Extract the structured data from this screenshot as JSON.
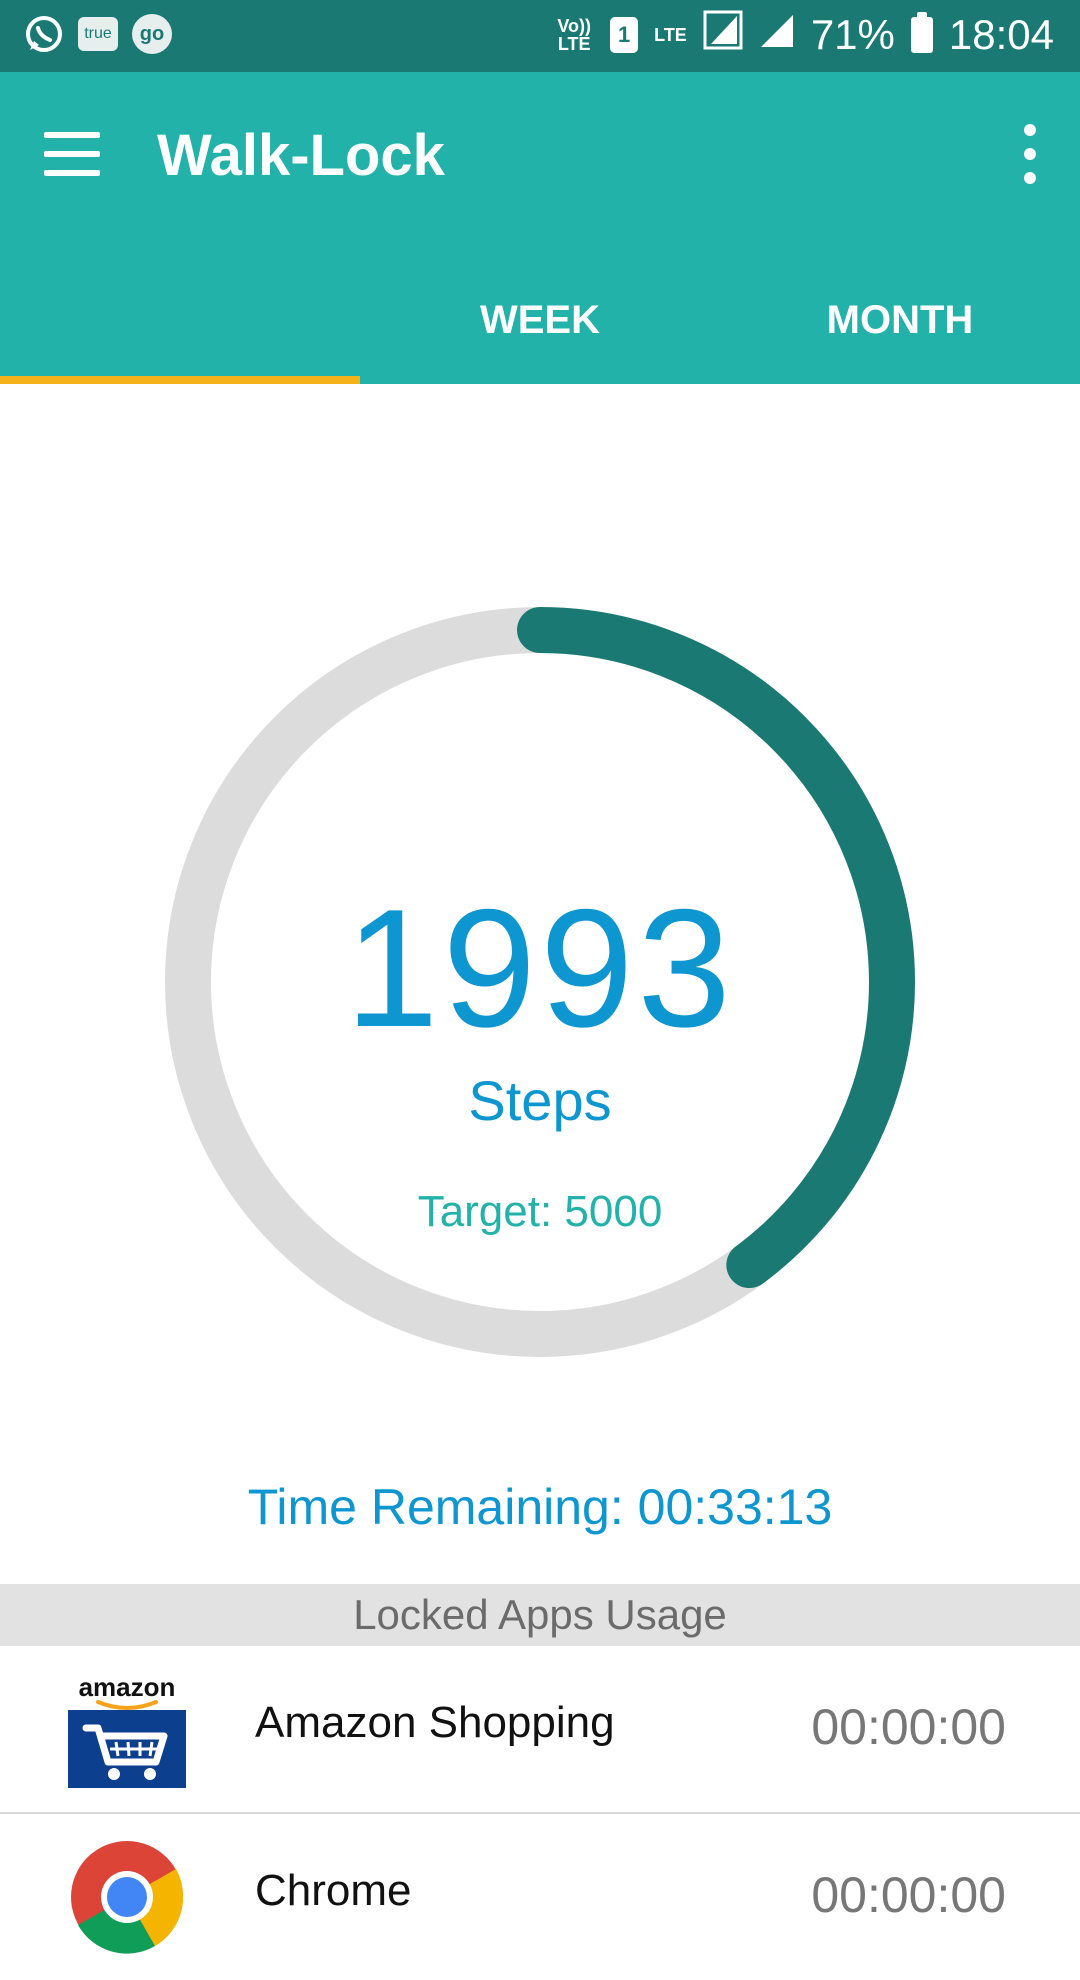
{
  "status_bar": {
    "left_icons": [
      "whatsapp-icon",
      "true-app-icon",
      "go-app-icon"
    ],
    "volte": "Vo)) LTE",
    "sim": "1",
    "lte": "LTE",
    "battery_percent": "71%",
    "time": "18:04"
  },
  "app_bar": {
    "title": "Walk-Lock",
    "tabs": [
      {
        "label": ""
      },
      {
        "label": "WEEK"
      },
      {
        "label": "MONTH"
      }
    ],
    "selected_tab": 0
  },
  "progress": {
    "steps": "1993",
    "steps_label": "Steps",
    "target_label": "Target: 5000",
    "fraction": 0.3986,
    "track_color": "#dcdcdc",
    "progress_color": "#1a7a73"
  },
  "time_remaining": "Time Remaining: 00:33:13",
  "locked_apps": {
    "header": "Locked Apps Usage",
    "items": [
      {
        "name": "Amazon Shopping",
        "time": "00:00:00",
        "icon": "amazon-icon",
        "icon_text": "amazon"
      },
      {
        "name": "Chrome",
        "time": "00:00:00",
        "icon": "chrome-icon"
      }
    ]
  },
  "colors": {
    "app_bar": "#22b2aa",
    "status_bar": "#1a7a73",
    "tab_indicator": "#f6b21b",
    "accent_text": "#0d96cf"
  }
}
